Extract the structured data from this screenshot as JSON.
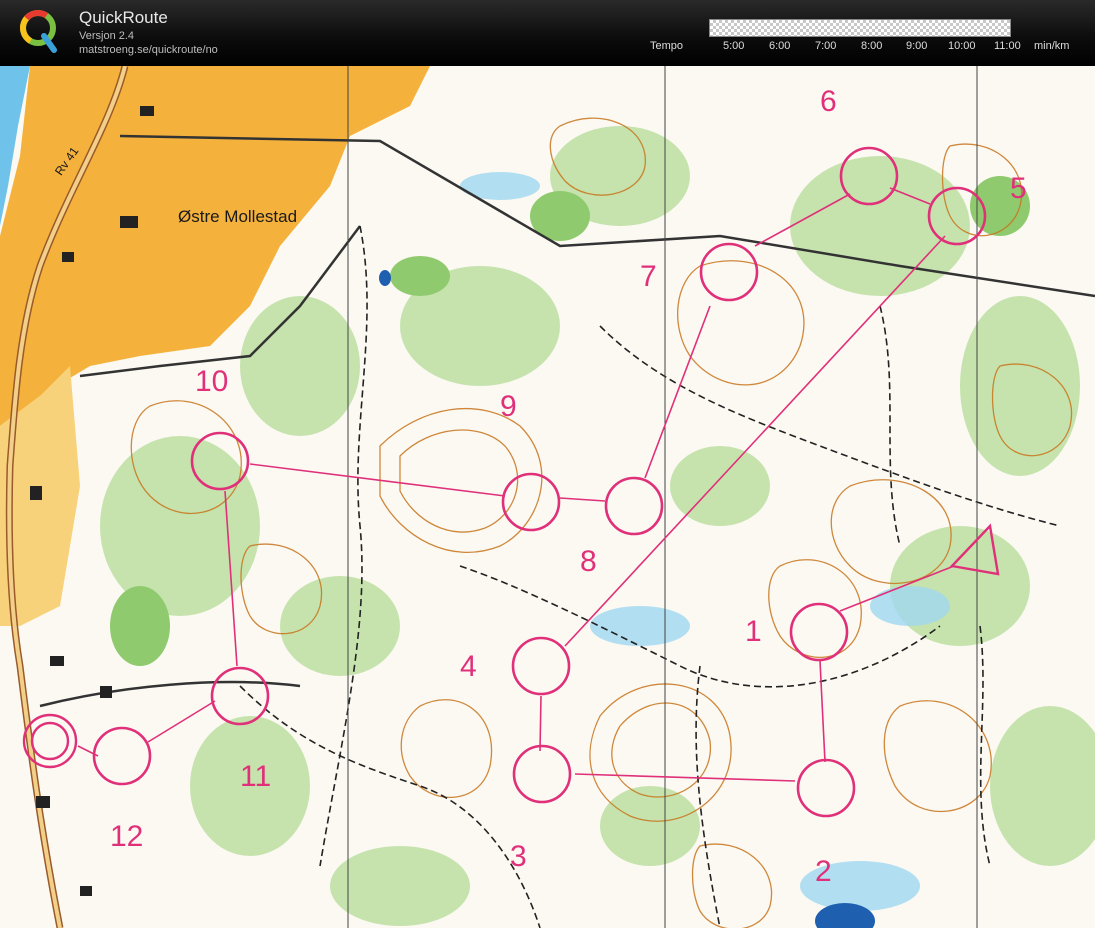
{
  "app": {
    "title": "QuickRoute",
    "version": "Versjon 2.4",
    "url": "matstroeng.se/quickroute/no"
  },
  "tempo": {
    "label": "Tempo",
    "ticks": [
      "5:00",
      "6:00",
      "7:00",
      "8:00",
      "9:00",
      "10:00",
      "11:00"
    ],
    "unit": "min/km"
  },
  "map": {
    "place_name": "Østre Mollestad",
    "road_label": "Rv 41",
    "course_color": "#e0307a",
    "control_numbers": [
      "1",
      "2",
      "3",
      "4",
      "5",
      "6",
      "7",
      "8",
      "9",
      "10",
      "11",
      "12"
    ]
  }
}
